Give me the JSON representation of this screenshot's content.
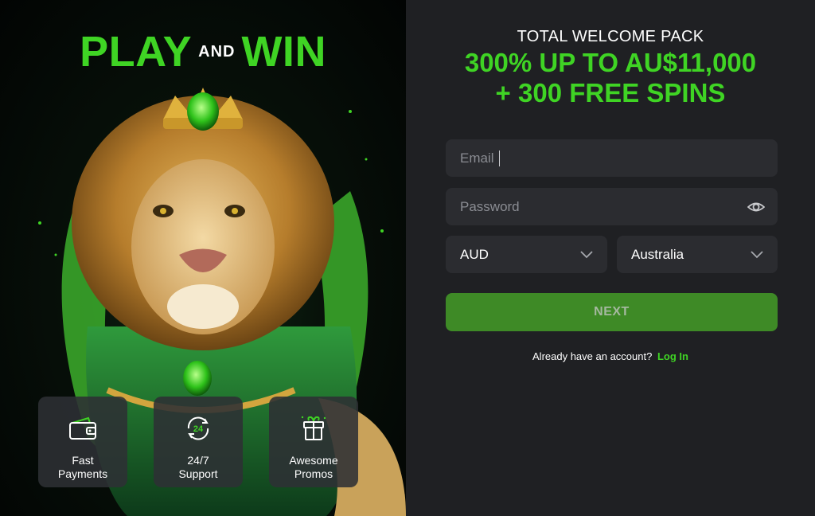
{
  "promo": {
    "title_left": "PLAY",
    "title_mid": "AND",
    "title_right": "WIN",
    "features": [
      {
        "icon": "wallet-icon",
        "label_line1": "Fast",
        "label_line2": "Payments"
      },
      {
        "icon": "clock-24-icon",
        "label_line1": "24/7",
        "label_line2": "Support"
      },
      {
        "icon": "gift-icon",
        "label_line1": "Awesome",
        "label_line2": "Promos"
      }
    ]
  },
  "offer": {
    "subtitle": "TOTAL WELCOME PACK",
    "line1": "300% UP TO AU$11,000",
    "line2": "+ 300 FREE SPINS"
  },
  "form": {
    "email_placeholder": "Email",
    "password_placeholder": "Password",
    "currency_value": "AUD",
    "country_value": "Australia",
    "next_label": "NEXT",
    "account_prompt": "Already have an account?",
    "login_link": "Log In"
  },
  "colors": {
    "accent_green": "#3fd424",
    "button_green": "#3e8a26",
    "panel_bg": "#1f2023",
    "field_bg": "#2b2c30"
  }
}
